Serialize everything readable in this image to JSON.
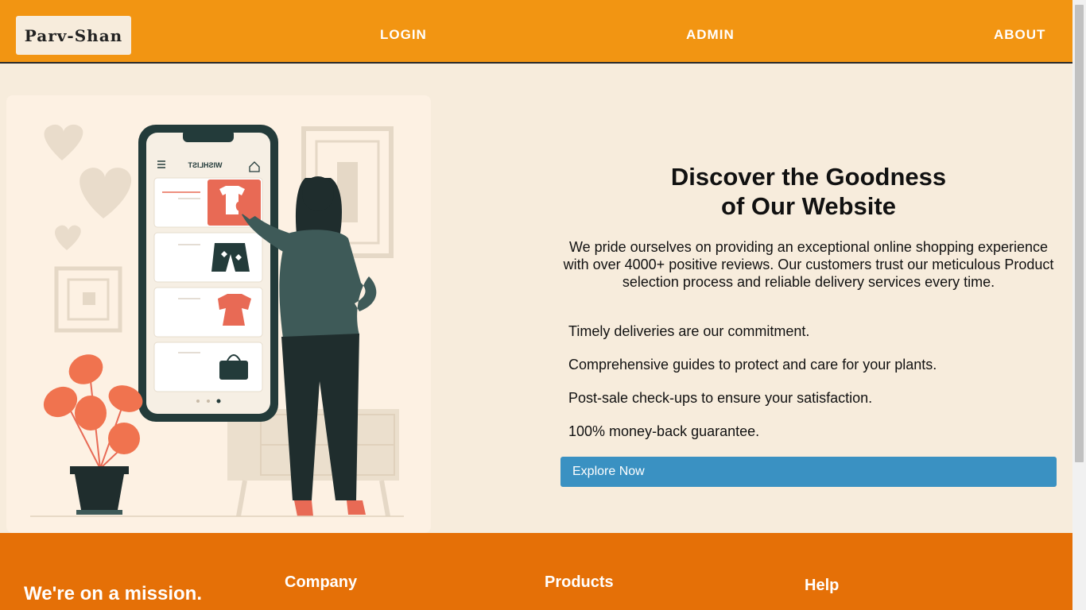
{
  "header": {
    "logo_text": "Parv-Shan",
    "nav": [
      {
        "label": "LOGIN"
      },
      {
        "label": "ADMIN"
      },
      {
        "label": "ABOUT"
      }
    ],
    "color": "#f29512"
  },
  "illustration": {
    "phone_screen_title": "WISHLIST"
  },
  "hero": {
    "title_line1": "Discover the Goodness",
    "title_line2": "of Our Website",
    "description": "We pride ourselves on providing an exceptional online shopping experience with over 4000+ positive reviews. Our customers trust our meticulous Product selection process and reliable delivery services every time.",
    "features": [
      "Timely deliveries are our commitment.",
      "Comprehensive guides to protect and care for your plants.",
      "Post-sale check-ups to ensure your satisfaction.",
      "100% money-back guarantee."
    ],
    "cta_label": "Explore Now",
    "cta_color": "#3a91c2"
  },
  "footer": {
    "mission": "We're on a mission.",
    "columns": [
      "Company",
      "Products",
      "Help"
    ],
    "color": "#e57007"
  }
}
